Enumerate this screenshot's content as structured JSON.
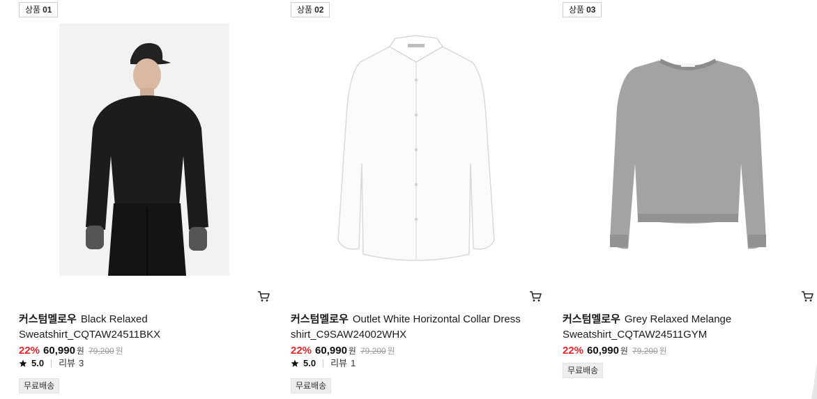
{
  "products": [
    {
      "tag_label": "상품",
      "tag_num": "01",
      "brand": "커스텀멜로우",
      "name": "Black Relaxed Sweatshirt_CQTAW24511BKX",
      "discount": "22%",
      "sale_price": "60,990",
      "won": "원",
      "original_price": "79,200",
      "rating": "5.0",
      "review_label": "리뷰",
      "review_count": "3",
      "badge": "무료배송",
      "image": "model-black-sweatshirt",
      "color": "#1c1c1c"
    },
    {
      "tag_label": "상품",
      "tag_num": "02",
      "brand": "커스텀멜로우",
      "name": "Outlet White Horizontal Collar Dress shirt_C9SAW24002WHX",
      "discount": "22%",
      "sale_price": "60,990",
      "won": "원",
      "original_price": "79,200",
      "rating": "5.0",
      "review_label": "리뷰",
      "review_count": "1",
      "badge": "무료배송",
      "image": "white-dress-shirt",
      "color": "#f7f7f7"
    },
    {
      "tag_label": "상품",
      "tag_num": "03",
      "brand": "커스텀멜로우",
      "name": "Grey Relaxed Melange Sweatshirt_CQTAW24511GYM",
      "discount": "22%",
      "sale_price": "60,990",
      "won": "원",
      "original_price": "79,200",
      "badge": "무료배송",
      "image": "grey-sweatshirt",
      "color": "#9c9c9c"
    }
  ],
  "icons": {
    "cart": "cart-icon",
    "star": "star-icon"
  },
  "colors": {
    "discount": "#e0262c",
    "badge_bg": "#eeeeee"
  }
}
